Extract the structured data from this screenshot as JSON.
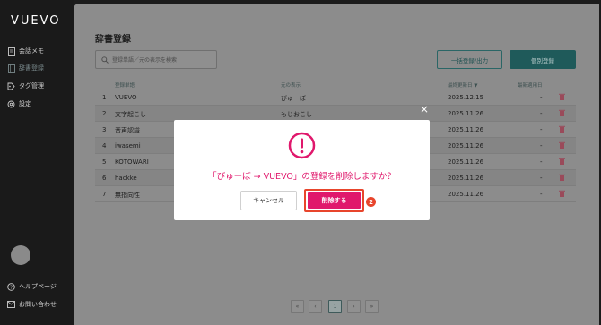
{
  "app": {
    "logo": "VUEVO"
  },
  "sidebar": {
    "items": [
      {
        "label": "会話メモ",
        "icon": "document-icon"
      },
      {
        "label": "辞書登録",
        "icon": "book-icon",
        "active": true
      },
      {
        "label": "タグ管理",
        "icon": "tag-icon"
      },
      {
        "label": "設定",
        "icon": "gear-icon"
      }
    ],
    "footer": [
      {
        "label": "ヘルプページ",
        "icon": "help-icon"
      },
      {
        "label": "お問い合わせ",
        "icon": "mail-icon"
      }
    ]
  },
  "main": {
    "title": "辞書登録",
    "search_placeholder": "登録単語／元の表示を検索",
    "bulk_button": "一括登録/出力",
    "single_button": "個別登録",
    "columns": {
      "word": "登録単語",
      "reading": "元の表示",
      "updated": "最終更新日 ▼",
      "used": "最新適用日"
    },
    "rows": [
      {
        "num": "1",
        "word": "VUEVO",
        "reading": "びゅーぼ",
        "updated": "2025.12.15",
        "used": "-"
      },
      {
        "num": "2",
        "word": "文字起こし",
        "reading": "もじおこし",
        "updated": "2025.11.26",
        "used": "-"
      },
      {
        "num": "3",
        "word": "音声認識",
        "reading": "",
        "updated": "2025.11.26",
        "used": "-"
      },
      {
        "num": "4",
        "word": "iwasemi",
        "reading": "",
        "updated": "2025.11.26",
        "used": "-"
      },
      {
        "num": "5",
        "word": "KOTOWARI",
        "reading": "",
        "updated": "2025.11.26",
        "used": "-"
      },
      {
        "num": "6",
        "word": "hackke",
        "reading": "",
        "updated": "2025.11.26",
        "used": "-"
      },
      {
        "num": "7",
        "word": "無指向性",
        "reading": "",
        "updated": "2025.11.26",
        "used": "-"
      }
    ],
    "pagination": {
      "first": "«",
      "prev": "‹",
      "current": "1",
      "next": "›",
      "last": "»"
    }
  },
  "modal": {
    "close": "×",
    "icon": "alert-icon",
    "message": "「びゅーぼ → VUEVO」の登録を削除しますか？",
    "cancel_label": "キャンセル",
    "delete_label": "削除する",
    "step_badge": "2"
  },
  "colors": {
    "accent": "#e0186c",
    "highlight": "#e8452c",
    "teal": "#1f5a5a"
  }
}
